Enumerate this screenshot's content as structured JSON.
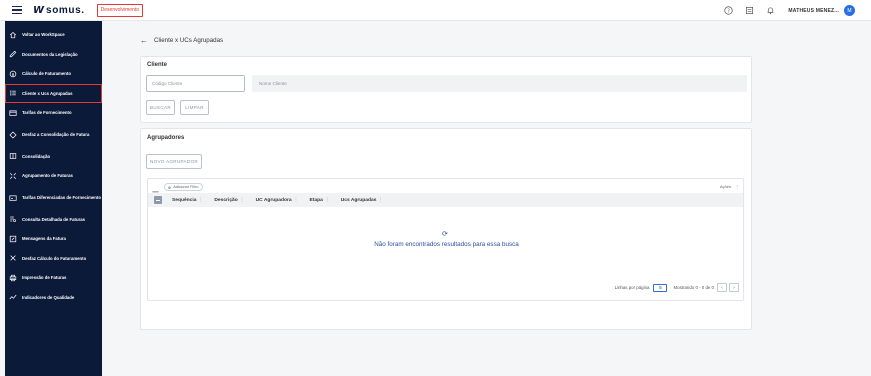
{
  "header": {
    "logo_text": "somus.",
    "environment_badge": "Desenvolvimento",
    "user_name": "MATHEUS MENEZ...",
    "avatar_initial": "M"
  },
  "sidebar": {
    "items": [
      {
        "label": "Voltar ao WorkSpace",
        "icon": "home-icon"
      },
      {
        "label": "Documentos da Legislação",
        "icon": "edit-document-icon"
      },
      {
        "label": "Cálculo de Faturamento",
        "icon": "money-cycle-icon"
      },
      {
        "label": "Cliente x Ucs Agrupadas",
        "icon": "list-icon",
        "active": true
      },
      {
        "label": "Tarifas de Fornecimento",
        "icon": "card-icon"
      },
      {
        "label": "Desfaz a Consolidação de Fatura",
        "icon": "undo-circle-icon"
      },
      {
        "label": "Consolidação",
        "icon": "book-icon"
      },
      {
        "label": "Agrupamento de Faturas",
        "icon": "group-icon"
      },
      {
        "label": "Tarifas Diferenciadas de Fornecimento",
        "icon": "card-money-icon"
      },
      {
        "label": "Consulta Detalhada de Faturas",
        "icon": "detail-list-icon"
      },
      {
        "label": "Mensagens da Fatura",
        "icon": "message-edit-icon"
      },
      {
        "label": "Desfaz Cálculo do Faturamento",
        "icon": "cancel-calc-icon"
      },
      {
        "label": "Impressão de Faturas",
        "icon": "print-icon"
      },
      {
        "label": "Indicadores de Qualidade",
        "icon": "chart-line-icon"
      }
    ]
  },
  "page": {
    "title": "Cliente x UCs Agrupadas"
  },
  "cliente_card": {
    "title": "Cliente",
    "codigo_placeholder": "Código Cliente",
    "nome_placeholder": "Nome Cliente",
    "buscar_label": "BUSCAR",
    "limpar_label": "LIMPAR"
  },
  "agrupadores_card": {
    "title": "Agrupadores",
    "novo_label": "NOVO AGRUPADOR",
    "add_filter_label": "Adicionar Filtro",
    "acoes_label": "Ações",
    "columns": [
      "Sequência",
      "Descrição",
      "UC Agrupadora",
      "Etapa",
      "Ucs Agrupadas"
    ],
    "empty_message": "Não foram encontrados resultados para essa busca",
    "rows_per_page_label": "Linhas por página",
    "rows_per_page_value": "5",
    "range_label": "Mostrando 0 - 0 de 0"
  },
  "colors": {
    "sidebar_bg": "#0c1a3a",
    "accent": "#2b6de2",
    "active_outline": "#e53935",
    "empty_text": "#2b4f9e"
  }
}
